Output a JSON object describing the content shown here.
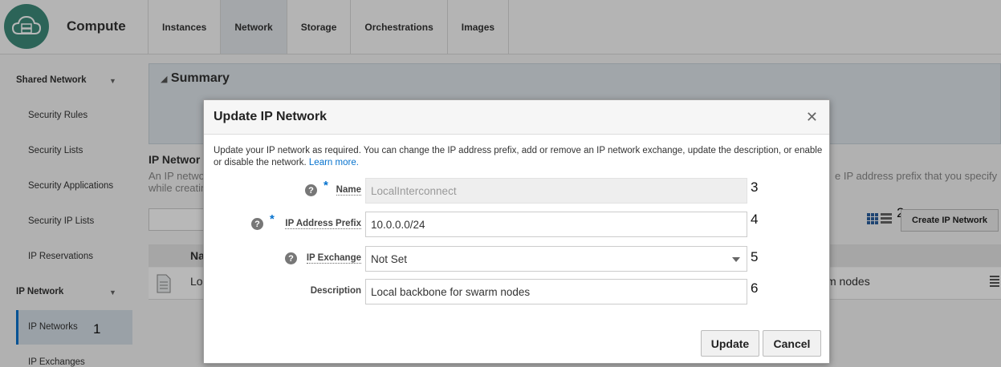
{
  "app": {
    "title": "Compute",
    "logo_icon": "cloud-server-icon"
  },
  "tabs": [
    {
      "label": "Instances"
    },
    {
      "label": "Network"
    },
    {
      "label": "Storage"
    },
    {
      "label": "Orchestrations"
    },
    {
      "label": "Images"
    }
  ],
  "sidebar": {
    "groups": [
      {
        "label": "Shared Network",
        "items": [
          "Security Rules",
          "Security Lists",
          "Security Applications",
          "Security IP Lists",
          "IP Reservations"
        ]
      },
      {
        "label": "IP Network",
        "items": [
          "IP Networks",
          "IP Exchanges"
        ]
      }
    ]
  },
  "background": {
    "summary_title": "Summary",
    "section_heading": "IP Networ",
    "desc_line1": "An IP netwo",
    "desc_line2": "while creatin",
    "desc_right": "e IP address prefix that you specify",
    "column_name": "Na",
    "row_name": "Lo",
    "row_desc": "m nodes",
    "create_button": "Create IP Network"
  },
  "annotations": [
    "1",
    "2",
    "3",
    "4",
    "5",
    "6"
  ],
  "modal": {
    "title": "Update IP Network",
    "description": "Update your IP network as required. You can change the IP address prefix, add or remove an IP network exchange, update the description, or enable or disable the network.",
    "learn_more": "Learn more.",
    "fields": {
      "name": {
        "label": "Name",
        "value": "LocalInterconnect",
        "required": true
      },
      "prefix": {
        "label": "IP Address Prefix",
        "value": "10.0.0.0/24",
        "required": true
      },
      "exchange": {
        "label": "IP Exchange",
        "value": "Not Set"
      },
      "description": {
        "label": "Description",
        "value": "Local backbone for swarm nodes"
      }
    },
    "update_button": "Update",
    "cancel_button": "Cancel"
  },
  "colors": {
    "accent": "#0572ce",
    "logo": "#3e8b7a"
  }
}
